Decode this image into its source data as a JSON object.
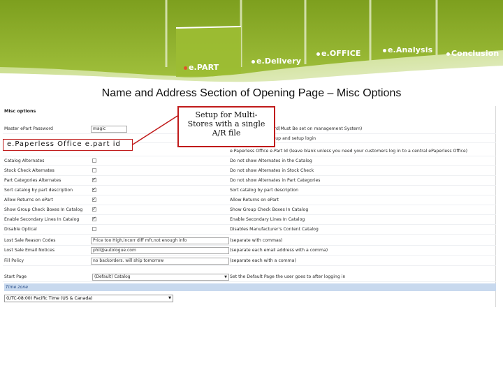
{
  "nav": {
    "tabs": [
      {
        "label": "e.PART",
        "active": true
      },
      {
        "label": "e.Delivery",
        "active": false
      },
      {
        "label": "e.OFFICE",
        "active": false
      },
      {
        "label": "e.Analysis",
        "active": false
      },
      {
        "label": "Conclusion",
        "active": false
      }
    ]
  },
  "slide_title": "Name and Address Section of Opening Page – Misc Options",
  "panel": {
    "header": "Misc options",
    "rows": [
      {
        "label": "Master ePart Password",
        "control": "input-short",
        "value": "magic",
        "desc": "Master ePart Password(Must Be set on management System)"
      },
      {
        "label": "",
        "control": "none",
        "value": "",
        "desc": "Not required to start up and setup login"
      },
      {
        "label": "",
        "control": "none",
        "value": "",
        "desc": "e.Paperless Office e.Part Id (leave blank unless you need your customers log in to a central ePaperless Office)"
      },
      {
        "label": "Catalog Alternates",
        "control": "checkbox",
        "checked": false,
        "desc": "Do not show Alternates in the Catalog"
      },
      {
        "label": "Stock Check Alternates",
        "control": "checkbox",
        "checked": false,
        "desc": "Do not show Alternates in Stock Check"
      },
      {
        "label": "Part Categories Alternates",
        "control": "checkbox",
        "checked": true,
        "desc": "Do not show Alternates in Part Categories"
      },
      {
        "label": "Sort catalog by part description",
        "control": "checkbox",
        "checked": true,
        "desc": "Sort catalog by part description"
      },
      {
        "label": "Allow Returns on ePart",
        "control": "checkbox",
        "checked": true,
        "desc": "Allow Returns on ePart"
      },
      {
        "label": "Show Group Check Boxes In Catalog",
        "control": "checkbox",
        "checked": true,
        "desc": "Show Group Check Boxes In Catalog"
      },
      {
        "label": "Enable Secondary Lines In Catalog",
        "control": "checkbox",
        "checked": true,
        "desc": "Enable Secondary Lines In Catalog"
      },
      {
        "label": "Disable Optical",
        "control": "checkbox",
        "checked": false,
        "desc": "Disables Manufacturer's Content Catalog"
      },
      {
        "label": "Lost Sale Reason Codes",
        "control": "input",
        "value": "Price too High,incorr diff mfr,not enough info",
        "desc": "(separate with commas)"
      },
      {
        "label": "Lost Sale Email Notices",
        "control": "input",
        "value": "phil@autologue.com",
        "desc": "(separate each email address with a comma)"
      },
      {
        "label": "Fill Policy",
        "control": "input",
        "value": "no backorders. will ship tomorrow",
        "desc": "(separate each with a comma)"
      },
      {
        "label": "Start Page",
        "control": "select",
        "value": "(Default) Catalog",
        "desc": "Set the Default Page the user goes to after logging in"
      }
    ],
    "timezone_header": "Time zone",
    "timezone_value": "(UTC-08:00) Pacific Time (US & Canada)"
  },
  "callouts": {
    "left": "e.Paperless Office e.part id",
    "right_lines": [
      "Setup for Multi-",
      "Stores with a single",
      "A/R file"
    ]
  },
  "colors": {
    "banner_green": "#8aab2a",
    "callout_border": "#c01a1a",
    "timezone_bar": "#c8d9ee"
  }
}
